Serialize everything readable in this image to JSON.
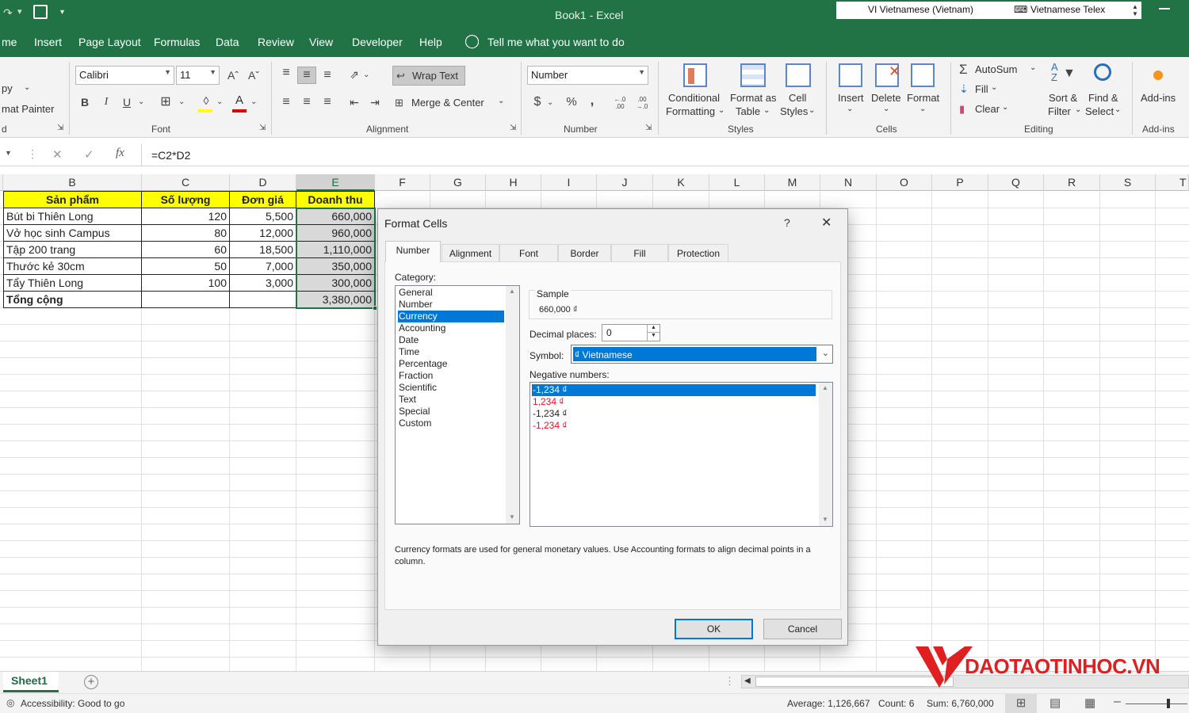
{
  "window": {
    "title": "Book1  -  Excel",
    "lang_indicator": "VI  Vietnamese (Vietnam)",
    "ime_indicator": "Vietnamese Telex"
  },
  "menu": {
    "items": [
      "me",
      "Insert",
      "Page Layout",
      "Formulas",
      "Data",
      "Review",
      "View",
      "Developer",
      "Help"
    ],
    "tell_me": "Tell me what you want to do"
  },
  "ribbon": {
    "clipboard": {
      "copy": "py",
      "format_painter": "mat Painter",
      "group_label": "d"
    },
    "font": {
      "name": "Calibri",
      "size": "11",
      "bold": "B",
      "italic": "I",
      "underline": "U",
      "group_label": "Font"
    },
    "alignment": {
      "wrap_text": "Wrap Text",
      "merge_center": "Merge & Center",
      "group_label": "Alignment"
    },
    "number": {
      "format": "Number",
      "currency_symbol": "$",
      "percent": "%",
      "comma": ",",
      "increase_decimal": "←.0 .00",
      "decrease_decimal": ".00 →.0",
      "group_label": "Number"
    },
    "styles": {
      "conditional_1": "Conditional",
      "conditional_2": "Formatting",
      "format_table_1": "Format as",
      "format_table_2": "Table",
      "cell_styles_1": "Cell",
      "cell_styles_2": "Styles",
      "group_label": "Styles"
    },
    "cells": {
      "insert": "Insert",
      "delete": "Delete",
      "format": "Format",
      "group_label": "Cells"
    },
    "editing": {
      "autosum": "AutoSum",
      "fill": "Fill",
      "clear": "Clear",
      "sort_1": "Sort &",
      "sort_2": "Filter",
      "find_1": "Find &",
      "find_2": "Select",
      "group_label": "Editing"
    },
    "addins": {
      "label": "Add-ins",
      "group_label": "Add-ins"
    }
  },
  "formula_bar": {
    "formula": "=C2*D2",
    "fx": "fx"
  },
  "columns": [
    "B",
    "C",
    "D",
    "E",
    "F",
    "G",
    "H",
    "I",
    "J",
    "K",
    "L",
    "M",
    "N",
    "O",
    "P",
    "Q",
    "R",
    "S",
    "T"
  ],
  "table": {
    "headers": [
      "Sản phẩm",
      "Số lượng",
      "Đơn giá",
      "Doanh thu"
    ],
    "rows": [
      [
        "Bút bi Thiên Long",
        "120",
        "5,500",
        "660,000"
      ],
      [
        "Vở học sinh Campus",
        "80",
        "12,000",
        "960,000"
      ],
      [
        "Tập 200 trang",
        "60",
        "18,500",
        "1,110,000"
      ],
      [
        "Thước kẻ 30cm",
        "50",
        "7,000",
        "350,000"
      ],
      [
        "Tẩy Thiên Long",
        "100",
        "3,000",
        "300,000"
      ]
    ],
    "total": [
      "Tổng cộng",
      "",
      "",
      "3,380,000"
    ],
    "header_color": "#ffff00",
    "selection_color": "#d9d9d9"
  },
  "sheet": {
    "tab": "Sheet1",
    "add": "+"
  },
  "status": {
    "accessibility": "Accessibility: Good to go",
    "average": "Average: 1,126,667",
    "count": "Count: 6",
    "sum": "Sum: 6,760,000"
  },
  "watermark": "DAOTAOTINHOC.VN",
  "dialog": {
    "title": "Format Cells",
    "help": "?",
    "close": "✕",
    "tabs": [
      "Number",
      "Alignment",
      "Font",
      "Border",
      "Fill",
      "Protection"
    ],
    "category_label": "Category:",
    "categories": [
      "General",
      "Number",
      "Currency",
      "Accounting",
      "Date",
      "Time",
      "Percentage",
      "Fraction",
      "Scientific",
      "Text",
      "Special",
      "Custom"
    ],
    "selected_category": "Currency",
    "sample_label": "Sample",
    "sample_value": "660,000 ₫",
    "decimal_label": "Decimal places:",
    "decimal_value": "0",
    "symbol_label": "Symbol:",
    "symbol_value": "₫ Vietnamese",
    "negative_label": "Negative numbers:",
    "negatives": [
      "-1,234 ₫",
      "1,234 ₫",
      "-1,234 ₫",
      "-1,234 ₫"
    ],
    "description": "Currency formats are used for general monetary values.  Use Accounting formats to align decimal points in a column.",
    "ok": "OK",
    "cancel": "Cancel",
    "accent_color": "#0078d7",
    "negative_red": "#e81123"
  }
}
